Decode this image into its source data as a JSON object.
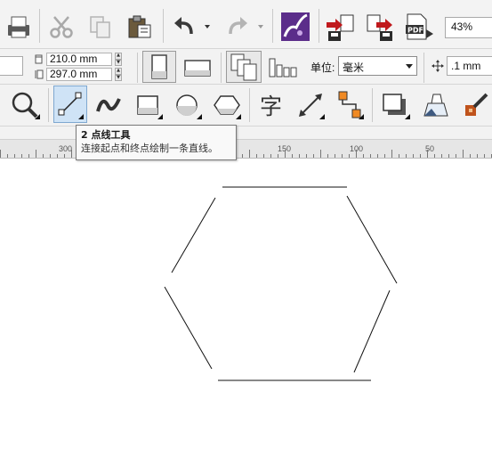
{
  "toolbar_standard": {
    "buttons": [
      {
        "name": "print-icon"
      },
      {
        "name": "cut-icon"
      },
      {
        "name": "copy-icon"
      },
      {
        "name": "paste-icon"
      },
      {
        "name": "undo-icon"
      },
      {
        "name": "redo-icon"
      },
      {
        "name": "corel-connect-icon"
      },
      {
        "name": "import-icon"
      },
      {
        "name": "export-icon"
      },
      {
        "name": "publish-pdf-icon"
      }
    ],
    "zoom_value": "43%"
  },
  "property_bar": {
    "page_width": "210.0 mm",
    "page_height": "297.0 mm",
    "unit_label": "单位:",
    "unit_value": "毫米",
    "nudge_value": ".1 mm"
  },
  "toolbox": {
    "active_tool": "2-point-line-tool"
  },
  "tooltip": {
    "title": "2 点线工具",
    "description": "连接起点和终点绘制一条直线。"
  },
  "ruler": {
    "labels": [
      "300",
      "150",
      "100",
      "50"
    ]
  },
  "colors": {
    "toolbar_bg": "#f2f2f2",
    "active_tool_bg": "#cfe3f6",
    "accent_purple": "#5b2d8a",
    "accent_red": "#c0191c",
    "hexagon_stroke": "#111111"
  }
}
